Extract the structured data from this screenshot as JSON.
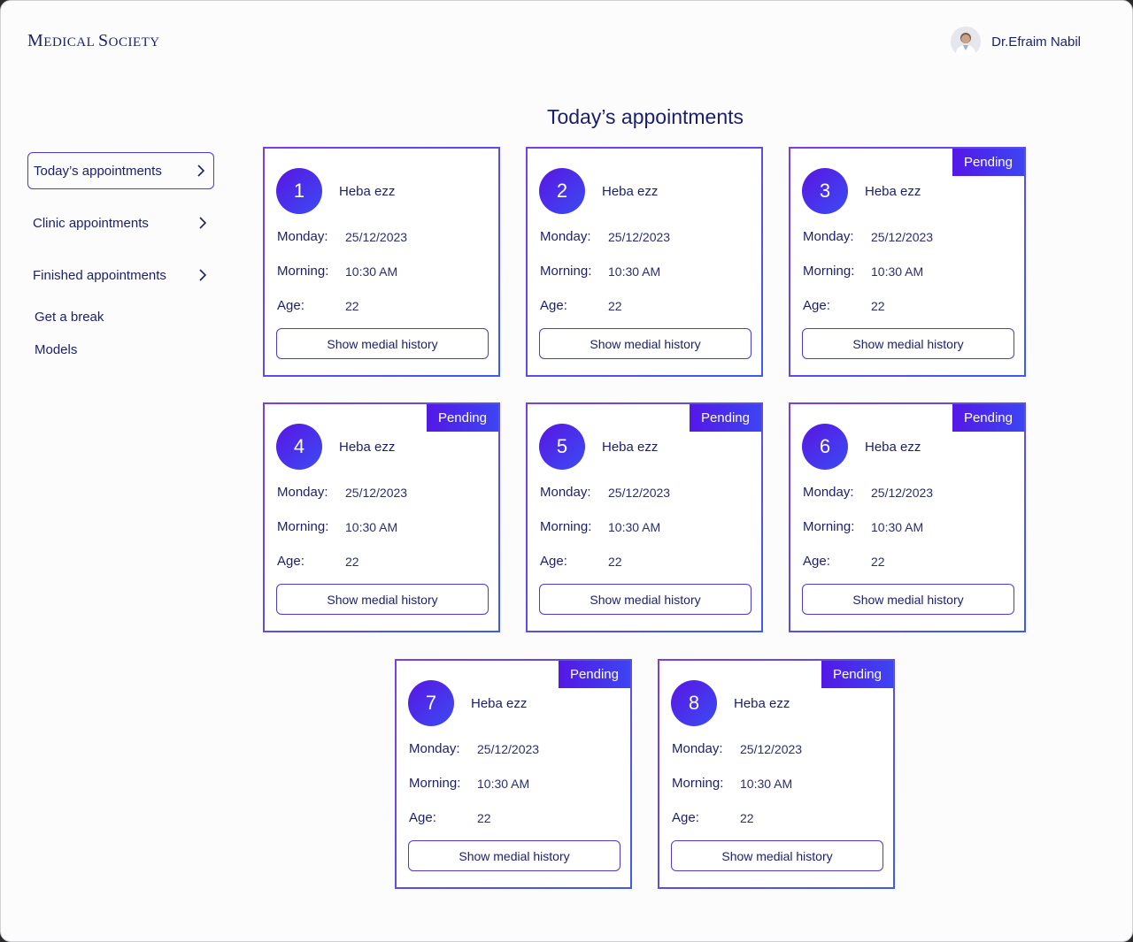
{
  "header": {
    "logo_initial_1": "M",
    "logo_rest_1": "EDICAL ",
    "logo_initial_2": "S",
    "logo_rest_2": "OCIETY",
    "user_name": "Dr.Efraim Nabil"
  },
  "page_title": "Today’s appointments",
  "sidebar": {
    "items": [
      {
        "label": "Today’s appointments",
        "icon": "chevron-right-icon"
      },
      {
        "label": "Clinic appointments",
        "icon": "chevron-right-icon"
      },
      {
        "label": "Finished appointments",
        "icon": "chevron-right-icon"
      }
    ],
    "extra": [
      "Get a break",
      "Models"
    ]
  },
  "cards": [
    {
      "number": "1",
      "name": "Heba ezz",
      "day_label": "Monday:",
      "date": "25/12/2023",
      "period_label": "Morning:",
      "time": "10:30 AM",
      "age_label": "Age:",
      "age": "22",
      "button": "Show medial history",
      "status": ""
    },
    {
      "number": "2",
      "name": "Heba ezz",
      "day_label": "Monday:",
      "date": "25/12/2023",
      "period_label": "Morning:",
      "time": "10:30 AM",
      "age_label": "Age:",
      "age": "22",
      "button": "Show medial history",
      "status": ""
    },
    {
      "number": "3",
      "name": "Heba ezz",
      "day_label": "Monday:",
      "date": "25/12/2023",
      "period_label": "Morning:",
      "time": "10:30 AM",
      "age_label": "Age:",
      "age": "22",
      "button": "Show medial history",
      "status": "Pending"
    },
    {
      "number": "4",
      "name": "Heba ezz",
      "day_label": "Monday:",
      "date": "25/12/2023",
      "period_label": "Morning:",
      "time": "10:30 AM",
      "age_label": "Age:",
      "age": "22",
      "button": "Show medial history",
      "status": "Pending"
    },
    {
      "number": "5",
      "name": "Heba ezz",
      "day_label": "Monday:",
      "date": "25/12/2023",
      "period_label": "Morning:",
      "time": "10:30 AM",
      "age_label": "Age:",
      "age": "22",
      "button": "Show medial history",
      "status": "Pending"
    },
    {
      "number": "6",
      "name": "Heba ezz",
      "day_label": "Monday:",
      "date": "25/12/2023",
      "period_label": "Morning:",
      "time": "10:30 AM",
      "age_label": "Age:",
      "age": "22",
      "button": "Show medial history",
      "status": "Pending"
    },
    {
      "number": "7",
      "name": "Heba ezz",
      "day_label": "Monday:",
      "date": "25/12/2023",
      "period_label": "Morning:",
      "time": "10:30 AM",
      "age_label": "Age:",
      "age": "22",
      "button": "Show medial history",
      "status": "Pending"
    },
    {
      "number": "8",
      "name": "Heba ezz",
      "day_label": "Monday:",
      "date": "25/12/2023",
      "period_label": "Morning:",
      "time": "10:30 AM",
      "age_label": "Age:",
      "age": "22",
      "button": "Show medial history",
      "status": "Pending"
    }
  ],
  "colors": {
    "text": "#1b1f6b",
    "accent_start": "#5a15e3",
    "accent_end": "#3a4cf3"
  }
}
